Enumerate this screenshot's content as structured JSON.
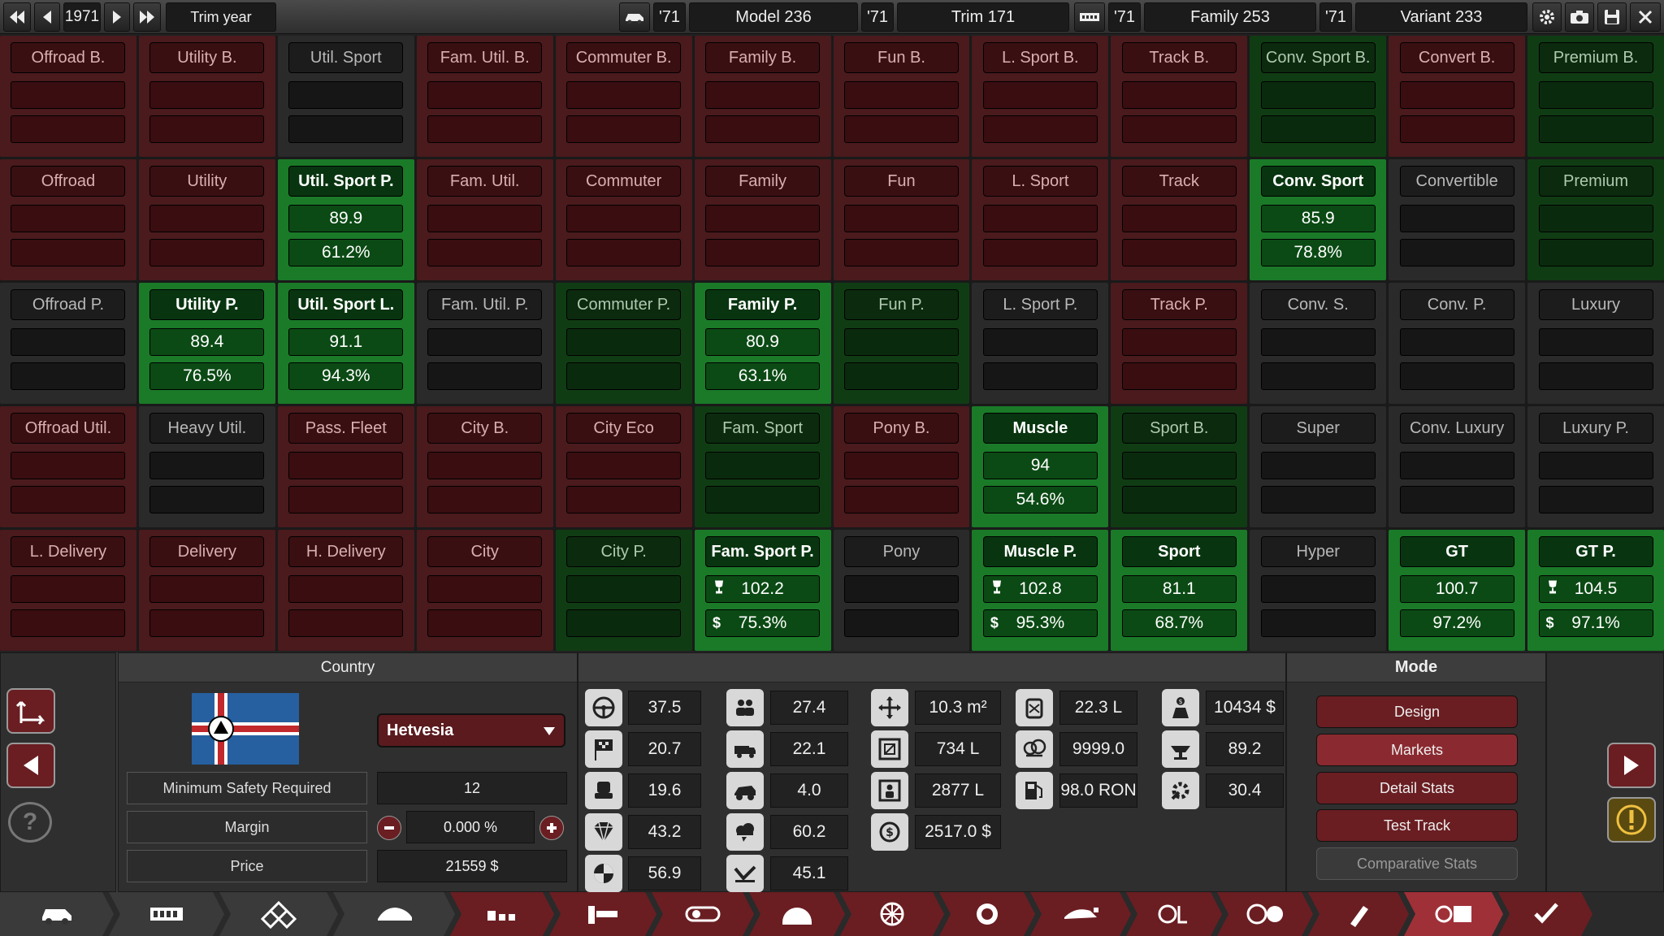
{
  "topbar": {
    "year": "1971",
    "trim_year_label": "Trim year",
    "model_year": "'71",
    "model": "Model 236",
    "trim_year": "'71",
    "trim": "Trim 171",
    "family_year": "'71",
    "family": "Family 253",
    "variant_year": "'71",
    "variant": "Variant 233"
  },
  "markets": [
    {
      "name": "Offroad B.",
      "state": "red",
      "v": "",
      "p": ""
    },
    {
      "name": "Utility B.",
      "state": "red",
      "v": "",
      "p": ""
    },
    {
      "name": "Util. Sport",
      "state": "gray",
      "v": "",
      "p": ""
    },
    {
      "name": "Fam. Util. B.",
      "state": "red",
      "v": "",
      "p": ""
    },
    {
      "name": "Commuter B.",
      "state": "red",
      "v": "",
      "p": ""
    },
    {
      "name": "Family B.",
      "state": "red",
      "v": "",
      "p": ""
    },
    {
      "name": "Fun B.",
      "state": "red",
      "v": "",
      "p": ""
    },
    {
      "name": "L. Sport B.",
      "state": "red",
      "v": "",
      "p": ""
    },
    {
      "name": "Track B.",
      "state": "red",
      "v": "",
      "p": ""
    },
    {
      "name": "Conv. Sport B.",
      "state": "green",
      "v": "",
      "p": ""
    },
    {
      "name": "Convert B.",
      "state": "red",
      "v": "",
      "p": ""
    },
    {
      "name": "Premium B.",
      "state": "green",
      "v": "",
      "p": ""
    },
    {
      "name": "Offroad",
      "state": "red",
      "v": "",
      "p": ""
    },
    {
      "name": "Utility",
      "state": "red",
      "v": "",
      "p": ""
    },
    {
      "name": "Util. Sport P.",
      "state": "lgreen",
      "v": "89.9",
      "p": "61.2%"
    },
    {
      "name": "Fam. Util.",
      "state": "red",
      "v": "",
      "p": ""
    },
    {
      "name": "Commuter",
      "state": "red",
      "v": "",
      "p": ""
    },
    {
      "name": "Family",
      "state": "red",
      "v": "",
      "p": ""
    },
    {
      "name": "Fun",
      "state": "red",
      "v": "",
      "p": ""
    },
    {
      "name": "L. Sport",
      "state": "red",
      "v": "",
      "p": ""
    },
    {
      "name": "Track",
      "state": "red",
      "v": "",
      "p": ""
    },
    {
      "name": "Conv. Sport",
      "state": "lgreen",
      "v": "85.9",
      "p": "78.8%"
    },
    {
      "name": "Convertible",
      "state": "gray",
      "v": "",
      "p": ""
    },
    {
      "name": "Premium",
      "state": "green",
      "v": "",
      "p": ""
    },
    {
      "name": "Offroad P.",
      "state": "gray",
      "v": "",
      "p": ""
    },
    {
      "name": "Utility P.",
      "state": "lgreen",
      "v": "89.4",
      "p": "76.5%"
    },
    {
      "name": "Util. Sport L.",
      "state": "lgreen",
      "v": "91.1",
      "p": "94.3%"
    },
    {
      "name": "Fam. Util. P.",
      "state": "gray",
      "v": "",
      "p": ""
    },
    {
      "name": "Commuter P.",
      "state": "green",
      "v": "",
      "p": ""
    },
    {
      "name": "Family P.",
      "state": "lgreen",
      "v": "80.9",
      "p": "63.1%"
    },
    {
      "name": "Fun P.",
      "state": "green",
      "v": "",
      "p": ""
    },
    {
      "name": "L. Sport P.",
      "state": "gray",
      "v": "",
      "p": ""
    },
    {
      "name": "Track P.",
      "state": "red",
      "v": "",
      "p": ""
    },
    {
      "name": "Conv. S.",
      "state": "gray",
      "v": "",
      "p": ""
    },
    {
      "name": "Conv. P.",
      "state": "gray",
      "v": "",
      "p": ""
    },
    {
      "name": "Luxury",
      "state": "gray",
      "v": "",
      "p": ""
    },
    {
      "name": "Offroad Util.",
      "state": "red",
      "v": "",
      "p": ""
    },
    {
      "name": "Heavy Util.",
      "state": "gray",
      "v": "",
      "p": ""
    },
    {
      "name": "Pass. Fleet",
      "state": "red",
      "v": "",
      "p": ""
    },
    {
      "name": "City B.",
      "state": "red",
      "v": "",
      "p": ""
    },
    {
      "name": "City Eco",
      "state": "red",
      "v": "",
      "p": ""
    },
    {
      "name": "Fam. Sport",
      "state": "green",
      "v": "",
      "p": ""
    },
    {
      "name": "Pony B.",
      "state": "red",
      "v": "",
      "p": ""
    },
    {
      "name": "Muscle",
      "state": "lgreen",
      "v": "94",
      "p": "54.6%"
    },
    {
      "name": "Sport B.",
      "state": "green",
      "v": "",
      "p": ""
    },
    {
      "name": "Super",
      "state": "gray",
      "v": "",
      "p": ""
    },
    {
      "name": "Conv. Luxury",
      "state": "gray",
      "v": "",
      "p": ""
    },
    {
      "name": "Luxury P.",
      "state": "gray",
      "v": "",
      "p": ""
    },
    {
      "name": "L. Delivery",
      "state": "red",
      "v": "",
      "p": ""
    },
    {
      "name": "Delivery",
      "state": "red",
      "v": "",
      "p": ""
    },
    {
      "name": "H. Delivery",
      "state": "red",
      "v": "",
      "p": ""
    },
    {
      "name": "City",
      "state": "red",
      "v": "",
      "p": ""
    },
    {
      "name": "City P.",
      "state": "green",
      "v": "",
      "p": ""
    },
    {
      "name": "Fam. Sport P.",
      "state": "lgreen",
      "v": "102.2",
      "p": "75.3%",
      "trophy": true,
      "dollar": true
    },
    {
      "name": "Pony",
      "state": "gray",
      "v": "",
      "p": ""
    },
    {
      "name": "Muscle P.",
      "state": "lgreen",
      "v": "102.8",
      "p": "95.3%",
      "trophy": true,
      "dollar": true
    },
    {
      "name": "Sport",
      "state": "lgreen",
      "v": "81.1",
      "p": "68.7%"
    },
    {
      "name": "Hyper",
      "state": "gray",
      "v": "",
      "p": ""
    },
    {
      "name": "GT",
      "state": "lgreen",
      "v": "100.7",
      "p": "97.2%"
    },
    {
      "name": "GT P.",
      "state": "lgreen",
      "v": "104.5",
      "p": "97.1%",
      "trophy": true,
      "dollar": true
    }
  ],
  "country": {
    "header": "Country",
    "selected": "Hetvesia",
    "min_safety_label": "Minimum Safety Required",
    "min_safety_value": "12",
    "margin_label": "Margin",
    "margin_value": "0.000 %",
    "price_label": "Price",
    "price_value": "21559 $"
  },
  "stats": {
    "c1": [
      "37.5",
      "20.7",
      "19.6",
      "43.2",
      "56.9"
    ],
    "c2": [
      "27.4",
      "22.1",
      "4.0",
      "60.2",
      "45.1"
    ],
    "c3": [
      "10.3 m²",
      "734 L",
      "2877 L",
      "2517.0 $"
    ],
    "c4": [
      "22.3 L",
      "9999.0",
      "98.0 RON"
    ],
    "c5": [
      "10434 $",
      "89.2",
      "30.4"
    ]
  },
  "mode": {
    "header": "Mode",
    "design": "Design",
    "markets": "Markets",
    "detail_stats": "Detail Stats",
    "test_track": "Test Track",
    "comparative_stats": "Comparative Stats"
  },
  "colors": {
    "accent_red": "#6a1e22",
    "good_green": "#1a7a28",
    "bad_red": "#4a1a1d"
  }
}
